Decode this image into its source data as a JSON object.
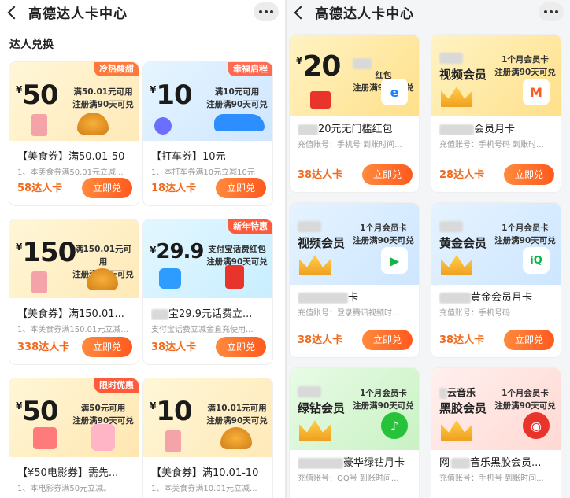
{
  "left": {
    "title": "高德达人卡中心",
    "section": "达人兑换",
    "cards": [
      {
        "tag": "冷热酸甜",
        "tag_color": "#ff7a3a",
        "amount": "50",
        "cond1": "满50.01元可用",
        "cond2": "注册满90天可兑",
        "name": "【美食券】满50.01-50",
        "desc": "1、本美食券满50.01元立减...",
        "price": "58达人卡",
        "btn": "立即兑"
      },
      {
        "tag": "幸福启程",
        "tag_color": "#ff6a50",
        "amount": "10",
        "cond1": "满10元可用",
        "cond2": "注册满90天可兑",
        "name": "【打车券】10元",
        "desc": "1、本打车券满10元立减10元",
        "price": "18达人卡",
        "btn": "立即兑"
      },
      {
        "tag": "",
        "tag_color": "",
        "amount": "150",
        "cond1": "满150.01元可用",
        "cond2": "注册满90天可兑",
        "name": "【美食券】满150.01...",
        "desc": "1、本美食券满150.01元立减...",
        "price": "338达人卡",
        "btn": "立即兑"
      },
      {
        "tag": "新年特惠",
        "tag_color": "#ff5a3a",
        "amount": "29.9",
        "cond1": "支付宝话费红包",
        "cond2": "注册满90天可兑",
        "name": "宝29.9元话费立...",
        "desc": "支付宝话费立减金直充使用...",
        "price": "38达人卡",
        "btn": "立即兑"
      },
      {
        "tag": "限时优惠",
        "tag_color": "#ff5a3a",
        "amount": "50",
        "cond1": "满50元可用",
        "cond2": "注册满90天可兑",
        "name": "【¥50电影券】需先...",
        "desc": "1、本电影券满50元立减。",
        "price": "",
        "btn": ""
      },
      {
        "tag": "",
        "tag_color": "",
        "amount": "10",
        "cond1": "满10.01元可用",
        "cond2": "注册满90天可兑",
        "name": "【美食券】满10.01-10",
        "desc": "1、本美食券满10.01元立减...",
        "price": "",
        "btn": ""
      }
    ]
  },
  "right": {
    "title": "高德达人卡中心",
    "cards": [
      {
        "kind": "amount",
        "amount": "20",
        "line1": "红包",
        "line2": "注册满90天可兑",
        "name": "20元无门槛红包",
        "desc": "充值账号：手机号 到账时间...",
        "price": "38达人卡",
        "btn": "立即兑",
        "icon": "e"
      },
      {
        "kind": "vip",
        "vip": "视频会员",
        "line1": "1个月会员卡",
        "line2": "注册满90天可兑",
        "name": "会员月卡",
        "desc": "充值账号：手机号码 到账时...",
        "price": "28达人卡",
        "btn": "立即兑",
        "icon": "M"
      },
      {
        "kind": "vip",
        "vip": "视频会员",
        "line1": "1个月会员卡",
        "line2": "注册满90天可兑",
        "name": "卡",
        "desc": "充值账号：登录腾讯视频时...",
        "price": "38达人卡",
        "btn": "立即兑",
        "icon": "▶"
      },
      {
        "kind": "vip",
        "vip": "黄金会员",
        "line1": "1个月会员卡",
        "line2": "注册满90天可兑",
        "name": "黄金会员月卡",
        "desc": "充值账号：手机号码",
        "price": "38达人卡",
        "btn": "立即兑",
        "icon": "iQ"
      },
      {
        "kind": "vip",
        "vip": "绿钻会员",
        "line1": "1个月会员卡",
        "line2": "注册满90天可兑",
        "name": "豪华绿钻月卡",
        "desc": "充值账号：QQ号 到账时间...",
        "price": "",
        "btn": "",
        "icon": "♪"
      },
      {
        "kind": "vip",
        "vip": "黑胶会员",
        "vip_top": "云音乐",
        "line1": "1个月会员卡",
        "line2": "注册满90天可兑",
        "name": "音乐黑胶会员...",
        "desc": "充值账号：手机号 到账时间...",
        "price": "",
        "btn": "",
        "icon": "◉"
      }
    ]
  }
}
